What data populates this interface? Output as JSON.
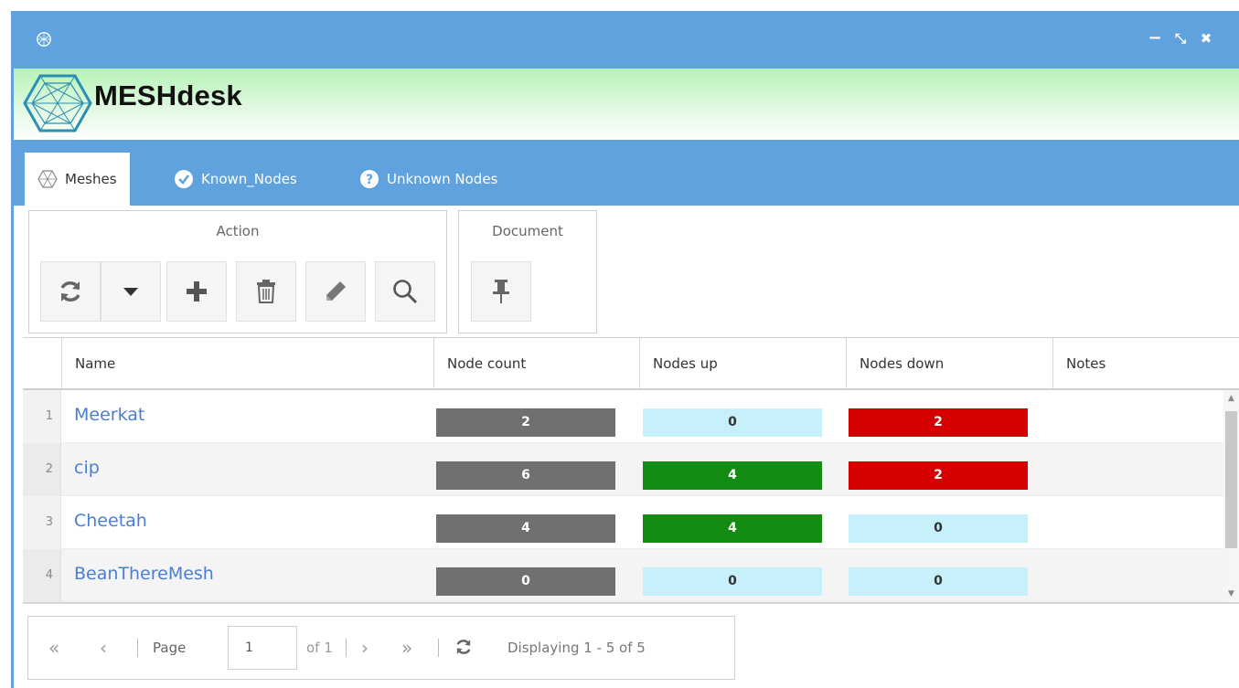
{
  "window": {
    "controls": {
      "minimize": "−",
      "restore": "⤡",
      "close": "✖"
    }
  },
  "banner": {
    "brand": "MESHdesk"
  },
  "tabs": [
    {
      "label": "Meshes",
      "icon": "mesh-icon",
      "active": true
    },
    {
      "label": "Known_Nodes",
      "icon": "check-circle-icon",
      "active": false
    },
    {
      "label": "Unknown Nodes",
      "icon": "question-circle-icon",
      "active": false
    }
  ],
  "toolbar": {
    "action_title": "Action",
    "document_title": "Document",
    "action_buttons": [
      "refresh-icon",
      "dropdown-caret-icon",
      "plus-icon",
      "trash-icon",
      "pencil-icon",
      "magnifier-icon"
    ],
    "document_buttons": [
      "pin-icon"
    ]
  },
  "grid": {
    "columns": [
      "Name",
      "Node count",
      "Nodes up",
      "Nodes down",
      "Notes"
    ],
    "rows": [
      {
        "num": "1",
        "name": "Meerkat",
        "node_count": "2",
        "nodes_up": "0",
        "nodes_down": "2",
        "notes": ""
      },
      {
        "num": "2",
        "name": "cip",
        "node_count": "6",
        "nodes_up": "4",
        "nodes_down": "2",
        "notes": ""
      },
      {
        "num": "3",
        "name": "Cheetah",
        "node_count": "4",
        "nodes_up": "4",
        "nodes_down": "0",
        "notes": ""
      },
      {
        "num": "4",
        "name": "BeanThereMesh",
        "node_count": "0",
        "nodes_up": "0",
        "nodes_down": "0",
        "notes": ""
      }
    ]
  },
  "colors": {
    "titlebar": "#5fa2dd",
    "badge_grey": "#707070",
    "badge_green": "#148c14",
    "badge_red": "#d60000",
    "badge_cyan": "#c6f1fb",
    "link": "#4a7ed2"
  },
  "pager": {
    "page_label": "Page",
    "page_value": "1",
    "of_label": "of 1",
    "display_text": "Displaying 1 - 5 of 5"
  }
}
